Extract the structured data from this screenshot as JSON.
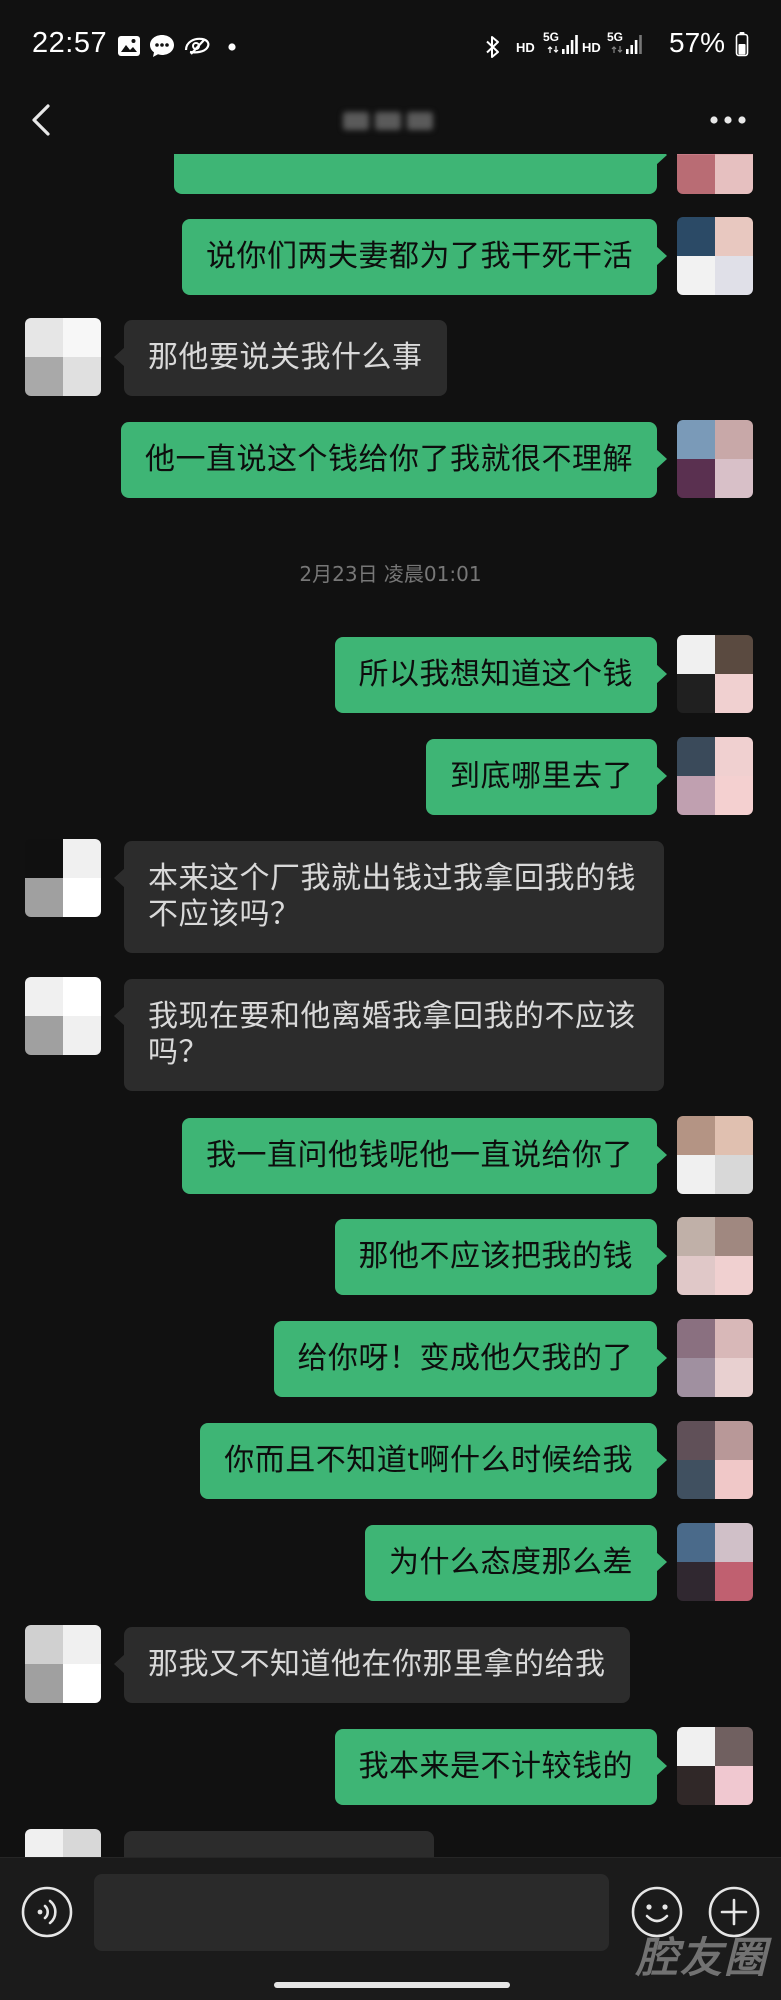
{
  "theme": {
    "background": "#111111",
    "self_bubble": "#3eb575",
    "other_bubble": "#2c2c2c",
    "input_bar": "#1b1b1b"
  },
  "status_bar": {
    "time": "22:57",
    "left_icons": [
      "gallery-icon",
      "message-icon",
      "app-icon",
      "dot-icon"
    ],
    "right_icons": [
      "bluetooth-icon",
      "signal-icon",
      "signal-icon",
      "battery-icon"
    ],
    "net_labels": [
      "HD",
      "5G",
      "HD",
      "5G"
    ],
    "battery_percent": "57%"
  },
  "header": {
    "back_icon": "chevron-left-icon",
    "more_icon": "more-icon"
  },
  "chat": {
    "timestamp": "2月23日 凌晨01:01",
    "messages": [
      {
        "from_self": true
      },
      {
        "from_self": true,
        "text": "说你们两夫妻都为了我干死干活"
      },
      {
        "from_self": false,
        "text": "那他要说关我什么事"
      },
      {
        "from_self": true,
        "text": "他一直说这个钱给你了我就很不理解"
      },
      {
        "from_self": true,
        "text": "所以我想知道这个钱"
      },
      {
        "from_self": true,
        "text": "到底哪里去了"
      },
      {
        "from_self": false,
        "text": "本来这个厂我就出钱过我拿回我的钱不应该吗？"
      },
      {
        "from_self": false,
        "text": "我现在要和他离婚我拿回我的不应该吗？"
      },
      {
        "from_self": true,
        "text": "我一直问他钱呢他一直说给你了"
      },
      {
        "from_self": true,
        "text": "那他不应该把我的钱"
      },
      {
        "from_self": true,
        "text": "给你呀！变成他欠我的了"
      },
      {
        "from_self": true,
        "text": "你而且不知道t啊什么时候给我"
      },
      {
        "from_self": true,
        "text": "为什么态度那么差"
      },
      {
        "from_self": false,
        "text": "那我又不知道他在你那里拿的给我"
      },
      {
        "from_self": true,
        "text": "我本来是不计较钱的"
      },
      {
        "from_self": false
      }
    ]
  },
  "input_bar": {
    "value": "",
    "icons": [
      "voice-icon",
      "emoji-icon",
      "plus-icon"
    ]
  },
  "watermark": "腔友圈"
}
